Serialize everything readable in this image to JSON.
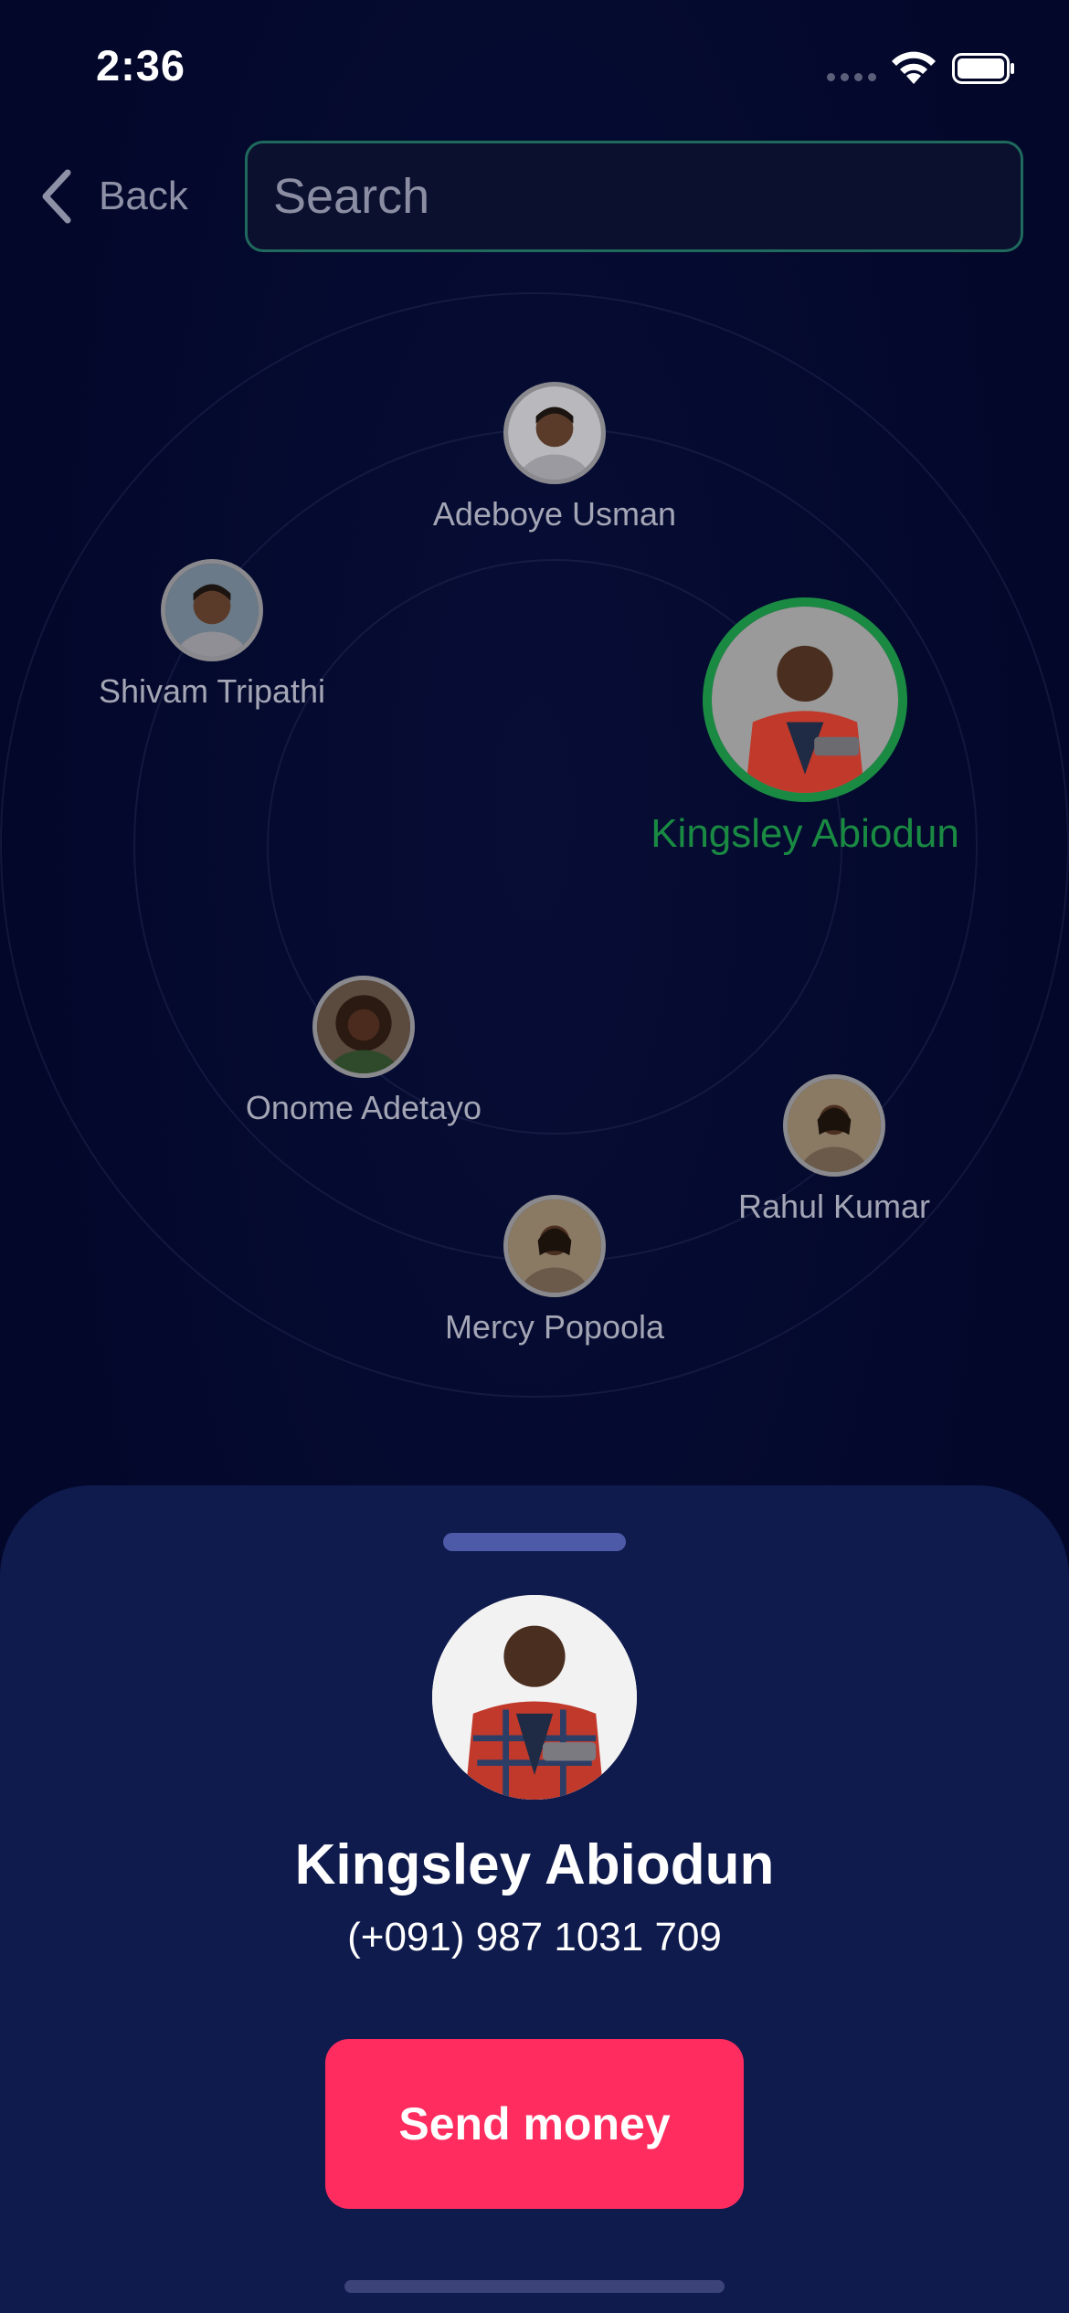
{
  "status_bar": {
    "time": "2:36"
  },
  "header": {
    "back_label": "Back",
    "search_placeholder": "Search"
  },
  "nearby": [
    {
      "name": "Adeboye Usman",
      "selected": false,
      "skin": "#5a3b2a",
      "shirt": "#9a9aa0"
    },
    {
      "name": "Shivam Tripathi",
      "selected": false,
      "skin": "#5a3b2a",
      "shirt": "#8f8f95"
    },
    {
      "name": "Kingsley Abiodun",
      "selected": true,
      "skin": "#4a2e1f",
      "shirt": "#c0392b"
    },
    {
      "name": "Onome Adetayo",
      "selected": false,
      "skin": "#4b2b1e",
      "shirt": "#2f4a2a"
    },
    {
      "name": "Rahul Kumar",
      "selected": false,
      "skin": "#4b2f20",
      "shirt": "#6b5a4a"
    },
    {
      "name": "Mercy Popoola",
      "selected": false,
      "skin": "#4b2f20",
      "shirt": "#6b5a4a"
    }
  ],
  "selected_contact": {
    "name": "Kingsley Abiodun",
    "phone": "(+091) 987 1031 709"
  },
  "actions": {
    "send_label": "Send money"
  },
  "colors": {
    "accent_green": "#1a8a43",
    "send_button": "#ff2d5f",
    "sheet_bg": "#0f1a4d"
  }
}
